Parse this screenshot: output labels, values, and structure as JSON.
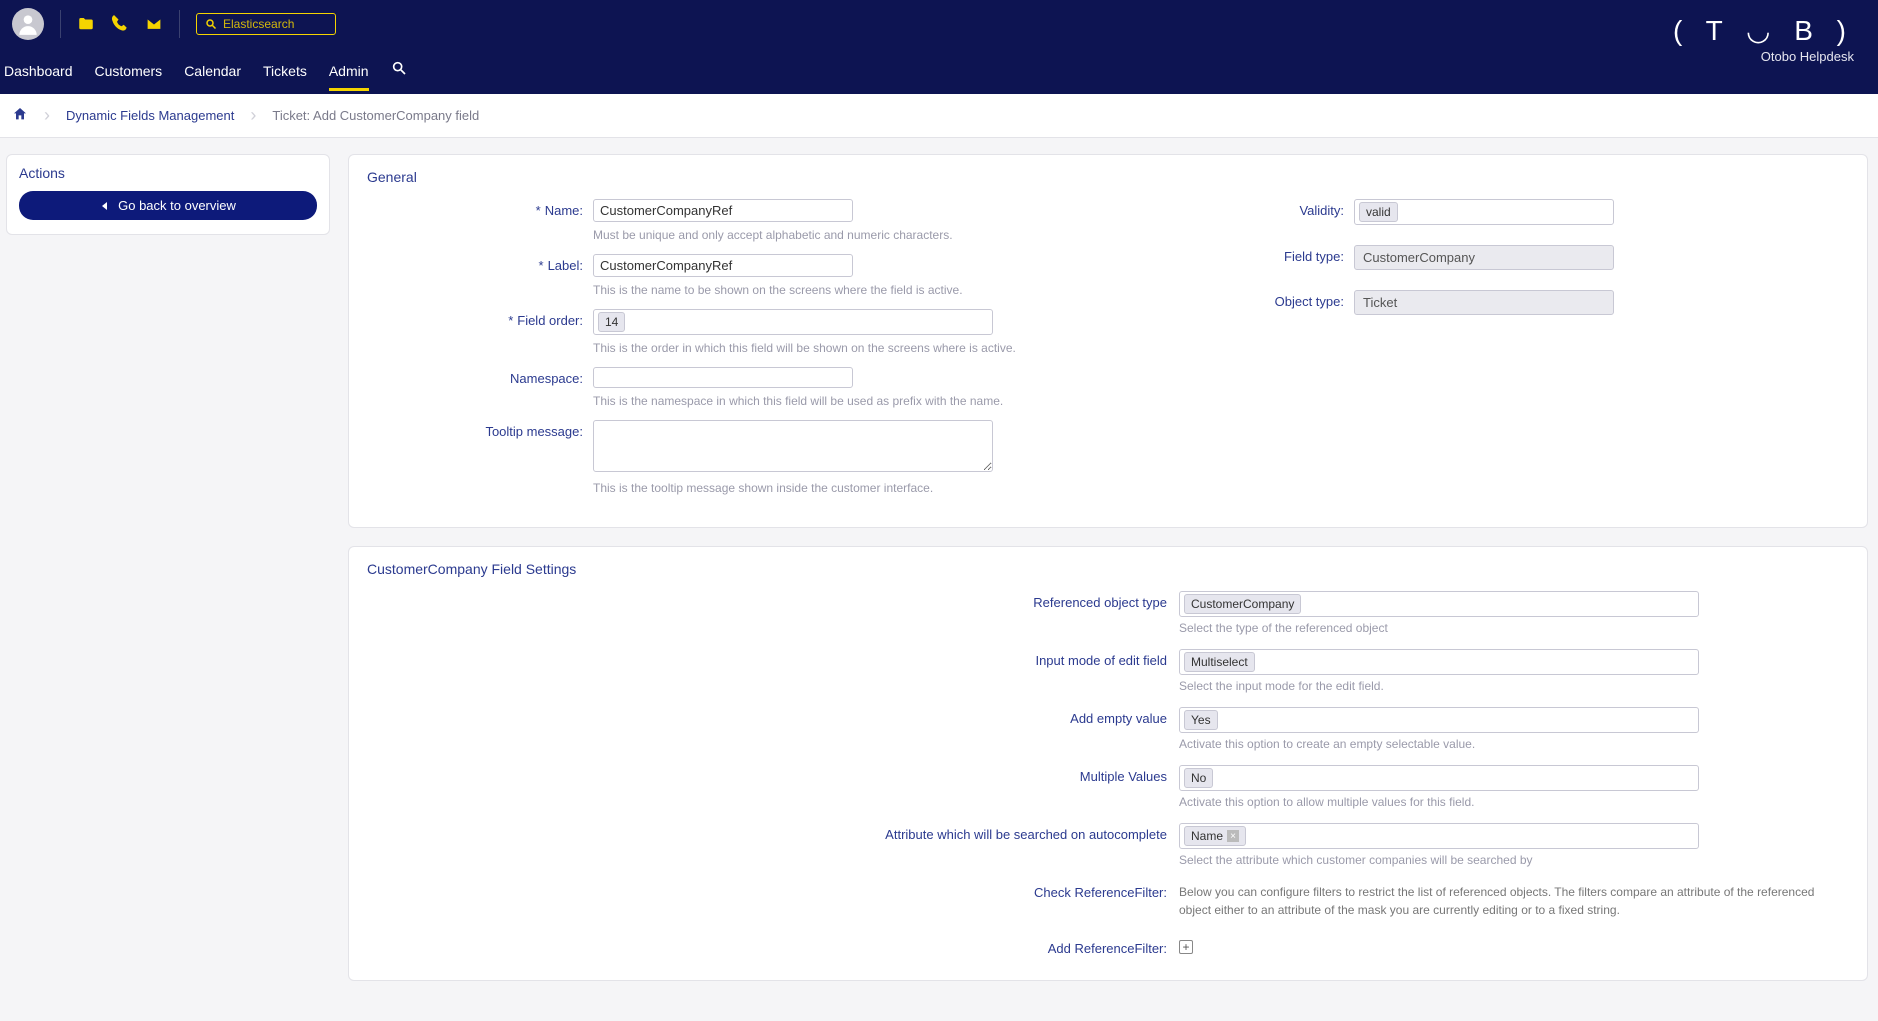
{
  "header": {
    "search_placeholder": "Elasticsearch",
    "brand_logo": "( T ◡ B )",
    "brand_name": "Otobo Helpdesk",
    "nav": [
      "Dashboard",
      "Customers",
      "Calendar",
      "Tickets",
      "Admin"
    ],
    "nav_active": "Admin"
  },
  "breadcrumb": {
    "item1": "Dynamic Fields Management",
    "item2": "Ticket: Add CustomerCompany field"
  },
  "sidebar": {
    "actions_title": "Actions",
    "back_label": "Go back to overview"
  },
  "general": {
    "title": "General",
    "name_label": "Name:",
    "name_value": "CustomerCompanyRef",
    "name_hint": "Must be unique and only accept alphabetic and numeric characters.",
    "label_label": "Label:",
    "label_value": "CustomerCompanyRef",
    "label_hint": "This is the name to be shown on the screens where the field is active.",
    "order_label": "Field order:",
    "order_value": "14",
    "order_hint": "This is the order in which this field will be shown on the screens where is active.",
    "namespace_label": "Namespace:",
    "namespace_value": "",
    "namespace_hint": "This is the namespace in which this field will be used as prefix with the name.",
    "tooltip_label": "Tooltip message:",
    "tooltip_value": "",
    "tooltip_hint": "This is the tooltip message shown inside the customer interface.",
    "validity_label": "Validity:",
    "validity_value": "valid",
    "fieldtype_label": "Field type:",
    "fieldtype_value": "CustomerCompany",
    "objecttype_label": "Object type:",
    "objecttype_value": "Ticket"
  },
  "settings": {
    "title": "CustomerCompany Field Settings",
    "refobj_label": "Referenced object type",
    "refobj_value": "CustomerCompany",
    "refobj_hint": "Select the type of the referenced object",
    "inputmode_label": "Input mode of edit field",
    "inputmode_value": "Multiselect",
    "inputmode_hint": "Select the input mode for the edit field.",
    "empty_label": "Add empty value",
    "empty_value": "Yes",
    "empty_hint": "Activate this option to create an empty selectable value.",
    "multi_label": "Multiple Values",
    "multi_value": "No",
    "multi_hint": "Activate this option to allow multiple values for this field.",
    "attr_label": "Attribute which will be searched on autocomplete",
    "attr_value": "Name",
    "attr_hint": "Select the attribute which customer companies will be searched by",
    "check_label": "Check ReferenceFilter:",
    "check_text": "Below you can configure filters to restrict the list of referenced objects. The filters compare an attribute of the referenced object either to an attribute of the mask you are currently editing or to a fixed string.",
    "addref_label": "Add ReferenceFilter:"
  }
}
